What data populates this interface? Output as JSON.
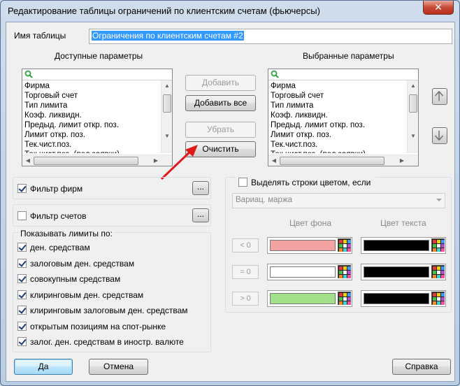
{
  "window": {
    "title": "Редактирование таблицы ограничений по клиентским счетам (фьючерсы)",
    "close_label": "✕"
  },
  "table_name": {
    "label": "Имя таблицы",
    "value": "Ограничения по клиентским счетам #2"
  },
  "available": {
    "heading": "Доступные параметры",
    "items": [
      "Фирма",
      "Торговый счет",
      "Тип лимита",
      "Коэф. ликвидн.",
      "Предыд. лимит откр. поз.",
      "Лимит откр. поз.",
      "Тек.чист.поз.",
      "Тек.чист.поз. (под заявки)"
    ]
  },
  "selected": {
    "heading": "Выбранные параметры",
    "items": [
      "Фирма",
      "Торговый счет",
      "Тип лимита",
      "Коэф. ликвидн.",
      "Предыд. лимит откр. поз.",
      "Лимит откр. поз.",
      "Тек.чист.поз.",
      "Тек.чист.поз. (под заявки)"
    ]
  },
  "buttons": {
    "add": "Добавить",
    "add_all": "Добавить все",
    "remove": "Убрать",
    "clear": "Очистить",
    "ok": "Да",
    "cancel": "Отмена",
    "help": "Справка",
    "dots": "..."
  },
  "filters": {
    "firms": {
      "label": "Фильтр фирм",
      "checked": true
    },
    "accounts": {
      "label": "Фильтр счетов",
      "checked": false
    }
  },
  "show_limits": {
    "heading": "Показывать лимиты по:",
    "items": [
      {
        "label": "ден. средствам",
        "checked": true
      },
      {
        "label": "залоговым ден. средствам",
        "checked": true
      },
      {
        "label": "совокупным средствам",
        "checked": true
      },
      {
        "label": "клиринговым ден. средствам",
        "checked": true
      },
      {
        "label": "клиринговым залоговым ден. средствам",
        "checked": true
      },
      {
        "label": "открытым позициям на спот-рынке",
        "checked": true
      },
      {
        "label": "залог. ден. средствам в иностр. валюте",
        "checked": true
      }
    ]
  },
  "highlight": {
    "label": "Выделять строки цветом, если",
    "checked": false,
    "field": "Вариац. маржа",
    "bg_header": "Цвет фона",
    "fg_header": "Цвет текста",
    "rows": [
      {
        "cmp": "< 0",
        "bg": "#f4a3a3",
        "fg": "#000000"
      },
      {
        "cmp": "= 0",
        "bg": "#ffffff",
        "fg": "#000000"
      },
      {
        "cmp": "> 0",
        "bg": "#a3e08a",
        "fg": "#000000"
      }
    ]
  },
  "colors": {
    "arrow": "#e01818",
    "search_icon": "#2e9e3e"
  },
  "icons": {
    "close": "close-icon",
    "search": "search-icon",
    "move_up": "arrow-up-icon",
    "move_down": "arrow-down-icon",
    "palette": "color-palette-icon"
  }
}
